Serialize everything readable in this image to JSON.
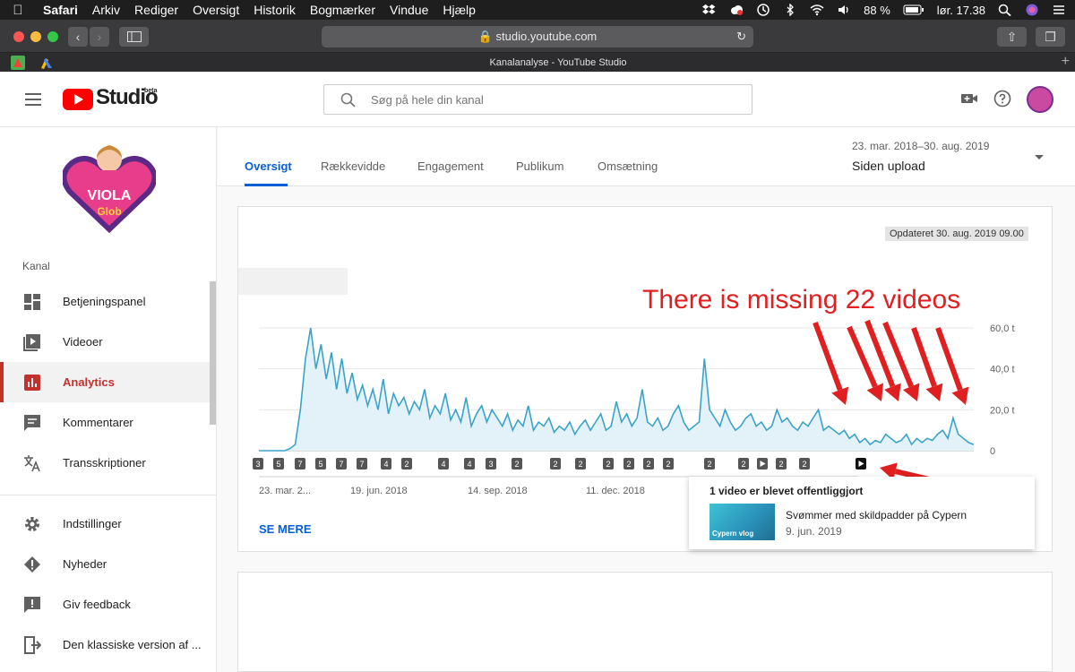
{
  "menubar": {
    "items": [
      "Safari",
      "Arkiv",
      "Rediger",
      "Oversigt",
      "Historik",
      "Bogmærker",
      "Vindue",
      "Hjælp"
    ],
    "battery": "88 %",
    "clock": "lør. 17.38"
  },
  "browser": {
    "url": "studio.youtube.com",
    "tab_title": "Kanalanalyse - YouTube Studio"
  },
  "header": {
    "logo_text": "Studio",
    "logo_badge": "beta",
    "search_placeholder": "Søg på hele din kanal"
  },
  "sidebar": {
    "section_label": "Kanal",
    "items": [
      {
        "label": "Betjeningspanel",
        "icon": "dashboard-icon"
      },
      {
        "label": "Videoer",
        "icon": "video-icon"
      },
      {
        "label": "Analytics",
        "icon": "analytics-icon",
        "active": true
      },
      {
        "label": "Kommentarer",
        "icon": "comment-icon"
      },
      {
        "label": "Transskriptioner",
        "icon": "translate-icon"
      }
    ],
    "bottom_items": [
      {
        "label": "Indstillinger",
        "icon": "gear-icon"
      },
      {
        "label": "Nyheder",
        "icon": "alert-icon"
      },
      {
        "label": "Giv feedback",
        "icon": "feedback-icon"
      },
      {
        "label": "Den klassiske version af ...",
        "icon": "exit-icon"
      }
    ],
    "channel_logo_text": [
      "VIOLA",
      "Glob"
    ]
  },
  "tabs": [
    "Oversigt",
    "Rækkevidde",
    "Engagement",
    "Publikum",
    "Omsætning"
  ],
  "date_range": {
    "range": "23. mar. 2018–30. aug. 2019",
    "label": "Siden upload"
  },
  "card": {
    "updated": "Opdateret 30. aug. 2019 09.00",
    "annotation": "There is missing 22 videos",
    "see_more": "SE MERE"
  },
  "chart_data": {
    "type": "area",
    "y_tick_labels": [
      "60,0 t",
      "40,0 t",
      "20,0 t",
      "0"
    ],
    "ylim": [
      0,
      60
    ],
    "x_tick_labels": [
      "23. mar. 2...",
      "19. jun. 2018",
      "14. sep. 2018",
      "11. dec. 2018"
    ],
    "series": [
      {
        "values": [
          0,
          0,
          0,
          0,
          0,
          0,
          1,
          3,
          20,
          45,
          60,
          40,
          52,
          35,
          48,
          30,
          45,
          28,
          38,
          25,
          32,
          22,
          30,
          20,
          35,
          18,
          28,
          22,
          26,
          18,
          24,
          20,
          30,
          16,
          22,
          18,
          28,
          15,
          20,
          14,
          26,
          12,
          18,
          22,
          14,
          20,
          16,
          12,
          18,
          10,
          15,
          12,
          22,
          10,
          14,
          12,
          16,
          9,
          12,
          10,
          14,
          8,
          12,
          15,
          10,
          14,
          18,
          10,
          12,
          24,
          14,
          18,
          12,
          16,
          30,
          14,
          12,
          16,
          10,
          12,
          18,
          22,
          14,
          10,
          12,
          14,
          45,
          20,
          16,
          12,
          20,
          14,
          10,
          12,
          16,
          18,
          12,
          14,
          10,
          12,
          20,
          14,
          16,
          12,
          10,
          14,
          12,
          16,
          20,
          10,
          12,
          10,
          8,
          10,
          6,
          8,
          4,
          6,
          3,
          5,
          4,
          8,
          6,
          4,
          5,
          8,
          3,
          6,
          4,
          6,
          5,
          8,
          10,
          6,
          16,
          8,
          6,
          4,
          3
        ]
      }
    ],
    "event_markers": [
      "3",
      "5",
      "7",
      "5",
      "7",
      "7",
      "4",
      "2",
      "4",
      "4",
      "3",
      "2",
      "2",
      "2",
      "2",
      "2",
      "2",
      "2",
      "2",
      "2",
      "play",
      "2",
      "2",
      "play"
    ],
    "ylabel": "",
    "xlabel": ""
  },
  "popup": {
    "title": "1 video er blevet offentliggjort",
    "thumb_text": "Cypern vlog",
    "video_title": "Svømmer med skildpadder på Cypern",
    "video_date": "9. jun. 2019"
  },
  "colors": {
    "line": "#3ba3c8",
    "fill": "#e3f2f8",
    "accent_red": "#c4302b",
    "annotation_red": "#e02020",
    "link_blue": "#065fd4"
  }
}
